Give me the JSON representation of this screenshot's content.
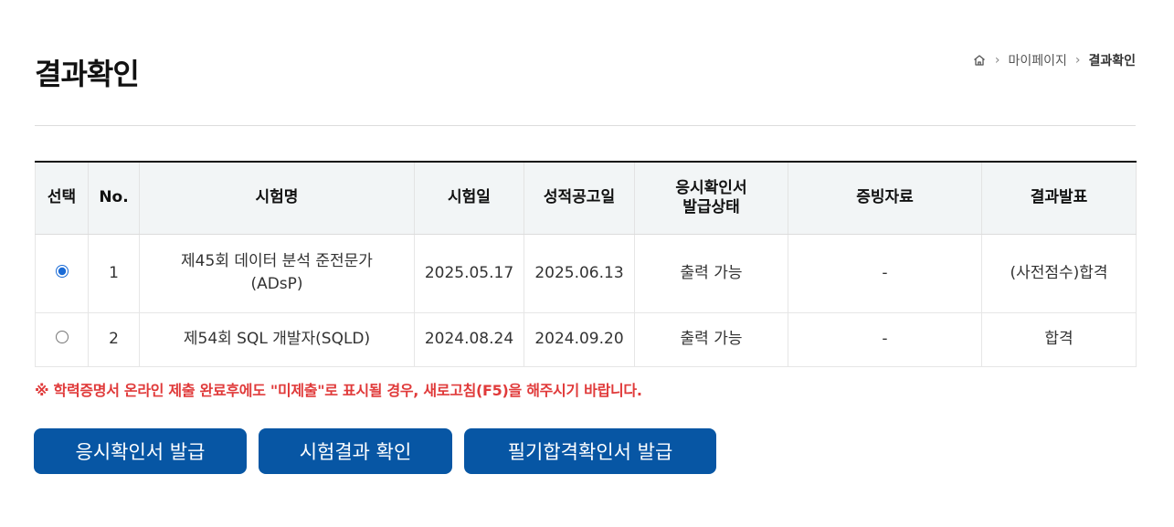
{
  "page": {
    "title": "결과확인"
  },
  "breadcrumb": {
    "level1": "마이페이지",
    "current": "결과확인",
    "home_icon": "home-icon"
  },
  "table": {
    "headers": {
      "select": "선택",
      "no": "No.",
      "exam_name": "시험명",
      "exam_date": "시험일",
      "score_date": "성적공고일",
      "admission_line1": "응시확인서",
      "admission_line2": "발급상태",
      "evidence": "증빙자료",
      "result": "결과발표"
    },
    "rows": [
      {
        "no": "1",
        "exam_name_line1": "제45회 데이터 분석 준전문가",
        "exam_name_line2": "(ADsP)",
        "exam_date": "2025.05.17",
        "score_date": "2025.06.13",
        "admission_status": "출력 가능",
        "evidence": "-",
        "result": "(사전점수)합격",
        "selected": true
      },
      {
        "no": "2",
        "exam_name_line1": "제54회 SQL 개발자(SQLD)",
        "exam_name_line2": "",
        "exam_date": "2024.08.24",
        "score_date": "2024.09.20",
        "admission_status": "출력 가능",
        "evidence": "-",
        "result": "합격",
        "selected": false
      }
    ]
  },
  "notice": "※ 학력증명서 온라인 제출 완료후에도 \"미제출\"로 표시될 경우, 새로고침(F5)을 해주시기 바랍니다.",
  "buttons": {
    "admission": "응시확인서 발급",
    "result_check": "시험결과 확인",
    "written_pass": "필기합격확인서 발급"
  },
  "colors": {
    "primary_button": "#0756a4",
    "notice_text": "#e03a3a",
    "header_bg": "#f2f5f6"
  }
}
